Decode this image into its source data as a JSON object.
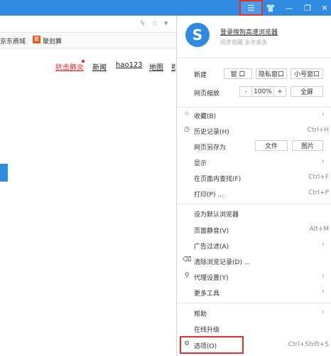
{
  "titlebar": {
    "menu_icon": "hamburger-icon",
    "skin_icon": "shirt-icon",
    "minimize_icon": "minimize-icon",
    "maximize_icon": "maximize-icon",
    "close_icon": "close-icon",
    "accent": "#2f8ae0"
  },
  "bookmarks": {
    "jd": "京东商城",
    "ju_badge": "聚",
    "ju": "聚划算"
  },
  "page_nav": {
    "items": [
      "抗击肺炎",
      "新闻",
      "hao123",
      "地图",
      "视"
    ]
  },
  "menu": {
    "login": "登录搜狗高速浏览器",
    "login_sub": "同步收藏 永不丢失",
    "new_label": "新建",
    "new_window": "窗 口",
    "private_window": "隐私窗口",
    "small_window": "小号窗口",
    "zoom_label": "网页缩放",
    "zoom_minus": "-",
    "zoom_value": "100%",
    "zoom_plus": "+",
    "fullscreen": "全屏",
    "favorites": "收藏(B)",
    "history": "历史记录(H)",
    "history_sc": "Ctrl+H",
    "save_as": "网页另存为",
    "save_file": "文件",
    "save_image": "图片",
    "display": "显示",
    "find": "在页面内查找(F)",
    "find_sc": "Ctrl+F",
    "print": "打印(P) ...",
    "print_sc": "Ctrl+P",
    "default_browser": "设为默认浏览器",
    "mute": "页面静音(V)",
    "mute_sc": "Alt+M",
    "adblock": "广告过滤(A)",
    "clear_history": "清除浏览记录(D) ...",
    "proxy": "代理设置(Y)",
    "more_tools": "更多工具",
    "help": "帮助",
    "upgrade": "在线升级",
    "options": "选项(O)",
    "options_sc": "Ctrl+Shift+S"
  }
}
